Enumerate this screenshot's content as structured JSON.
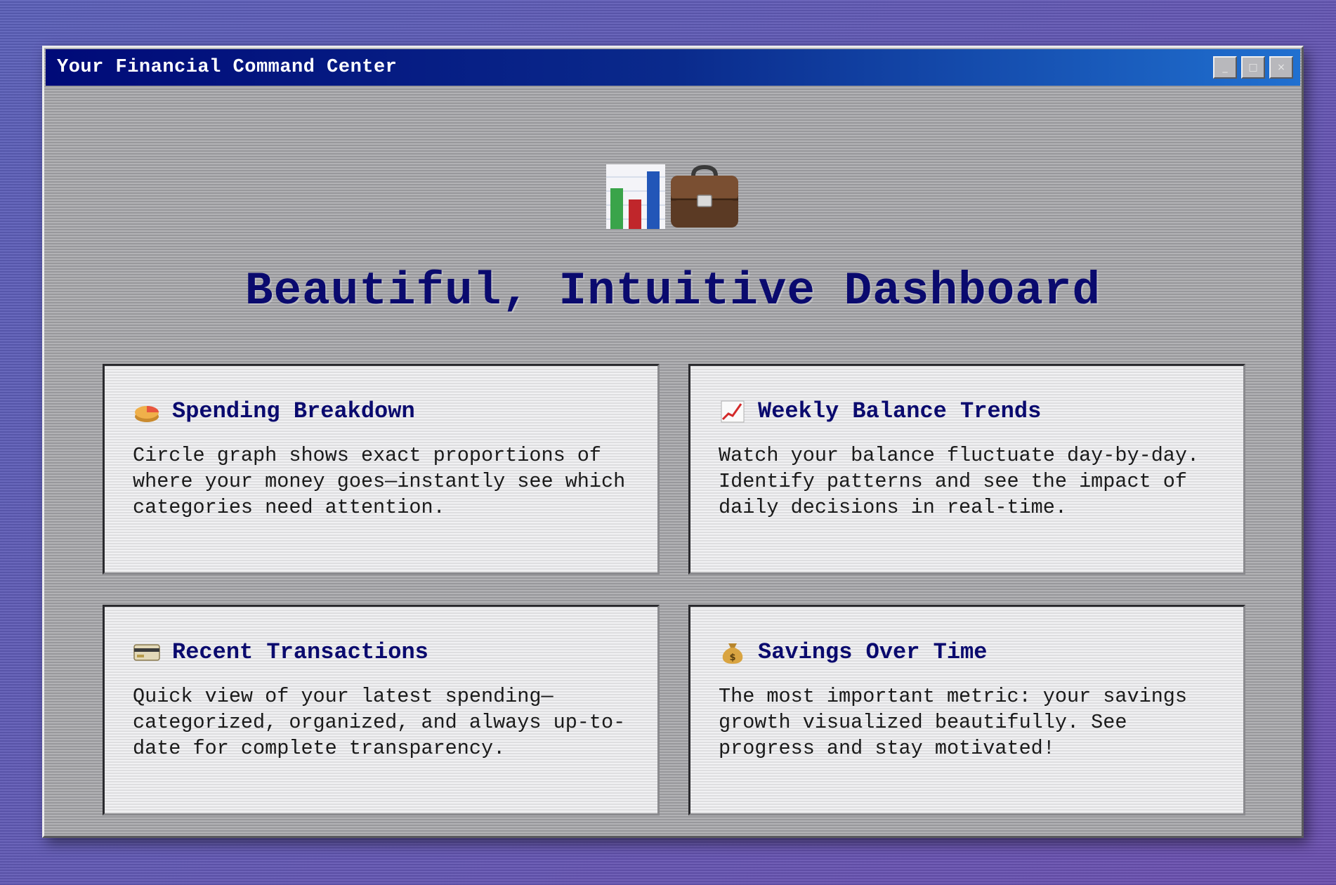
{
  "window": {
    "title": "Your Financial Command Center",
    "controls": {
      "minimize_label": "_",
      "maximize_label": "□",
      "close_label": "×"
    }
  },
  "hero": {
    "icons": [
      "bar-chart-icon",
      "briefcase-icon"
    ],
    "title": "Beautiful, Intuitive Dashboard"
  },
  "cards": [
    {
      "icon": "pie-chart-icon",
      "title": "Spending Breakdown",
      "body": "Circle graph shows exact proportions of where your money goes—instantly see which categories need attention."
    },
    {
      "icon": "trend-chart-icon",
      "title": "Weekly Balance Trends",
      "body": "Watch your balance fluctuate day-by-day. Identify patterns and see the impact of daily decisions in real-time."
    },
    {
      "icon": "credit-card-icon",
      "title": "Recent Transactions",
      "body": "Quick view of your latest spending—categorized, organized, and always up-to-date for complete transparency."
    },
    {
      "icon": "money-bag-icon",
      "title": "Savings Over Time",
      "body": "The most important metric: your savings growth visualized beautifully. See progress and stay motivated!"
    }
  ],
  "colors": {
    "title_bar_start": "#000a78",
    "title_bar_end": "#2070d0",
    "heading": "#0a0a6e",
    "window_face": "#a9a9ad",
    "desktop": "#5a5fb8"
  }
}
